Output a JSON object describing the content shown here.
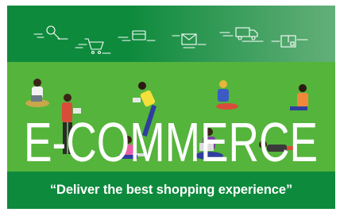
{
  "banner": {
    "headline": "E-COMMERCE",
    "tagline": "“Deliver the best shopping experience”",
    "colors": {
      "dark_green": "#0e8a3c",
      "scene_green": "#55b43b",
      "text": "#ffffff"
    }
  },
  "icons": [
    {
      "name": "search-icon"
    },
    {
      "name": "shopping-cart-icon"
    },
    {
      "name": "credit-card-icon"
    },
    {
      "name": "mail-icon"
    },
    {
      "name": "delivery-truck-icon"
    },
    {
      "name": "package-box-icon"
    }
  ]
}
